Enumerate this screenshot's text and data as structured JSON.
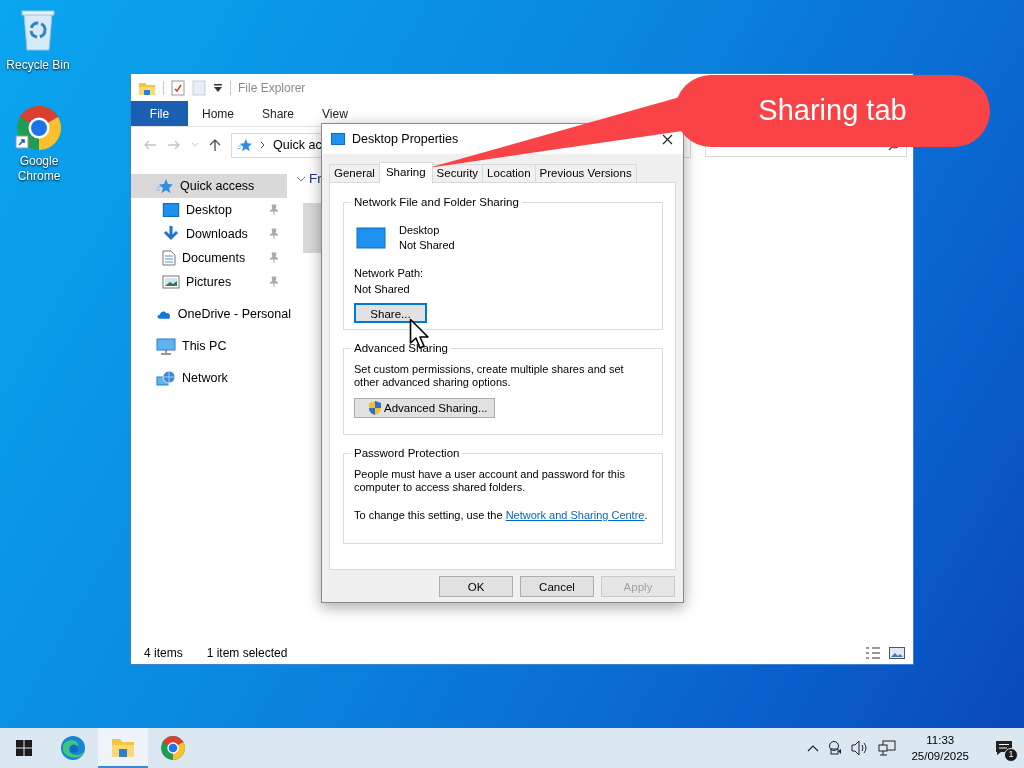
{
  "desktop_icons": [
    {
      "label": "Recycle Bin"
    },
    {
      "label": "Google Chrome"
    }
  ],
  "explorer": {
    "title": "File Explorer",
    "ribbon_tabs": [
      {
        "label": "File",
        "kind": "file"
      },
      {
        "label": "Home",
        "kind": "tab"
      },
      {
        "label": "Share",
        "kind": "tab"
      },
      {
        "label": "View",
        "kind": "tab"
      }
    ],
    "address": "Quick ac",
    "section_header": "Fr",
    "nav": [
      {
        "label": "Quick access",
        "selected": true,
        "children": [
          {
            "label": "Desktop",
            "selected": false,
            "pinned": true
          },
          {
            "label": "Downloads",
            "selected": false,
            "pinned": true
          },
          {
            "label": "Documents",
            "selected": false,
            "pinned": true
          },
          {
            "label": "Pictures",
            "selected": false,
            "pinned": true
          }
        ]
      },
      {
        "label": "OneDrive - Personal",
        "selected": false
      },
      {
        "label": "This PC",
        "selected": false
      },
      {
        "label": "Network",
        "selected": false
      }
    ],
    "status_bar": {
      "count": "4 items",
      "selection": "1 item selected"
    }
  },
  "dialog": {
    "title": "Desktop Properties",
    "tabs": [
      {
        "label": "General",
        "selected": false
      },
      {
        "label": "Sharing",
        "selected": true
      },
      {
        "label": "Security",
        "selected": false
      },
      {
        "label": "Location",
        "selected": false
      },
      {
        "label": "Previous Versions",
        "selected": false
      }
    ],
    "sharing_group": {
      "legend": "Network File and Folder Sharing",
      "folder_name": "Desktop",
      "folder_status": "Not Shared",
      "path_label": "Network Path:",
      "path_value": "Not Shared",
      "button": {
        "label": "Share...",
        "focused": true
      }
    },
    "advanced_group": {
      "legend": "Advanced Sharing",
      "text": "Set custom permissions, create multiple shares and set other advanced sharing options.",
      "button": "Advanced Sharing..."
    },
    "password_group": {
      "legend": "Password Protection",
      "text": "People must have a user account and password for this computer to access shared folders.",
      "note_prefix": "To change this setting, use the ",
      "link": "Network and Sharing Centre",
      "note_suffix": "."
    },
    "buttons": [
      {
        "label": "OK",
        "disabled": false
      },
      {
        "label": "Cancel",
        "disabled": false
      },
      {
        "label": "Apply",
        "disabled": true
      }
    ]
  },
  "callout": {
    "text": "Sharing tab"
  },
  "taskbar": {
    "apps": [
      {
        "active": false
      },
      {
        "active": true
      },
      {
        "active": false
      }
    ],
    "time": "11:33",
    "date": "25/09/2025",
    "notifications": "1"
  }
}
